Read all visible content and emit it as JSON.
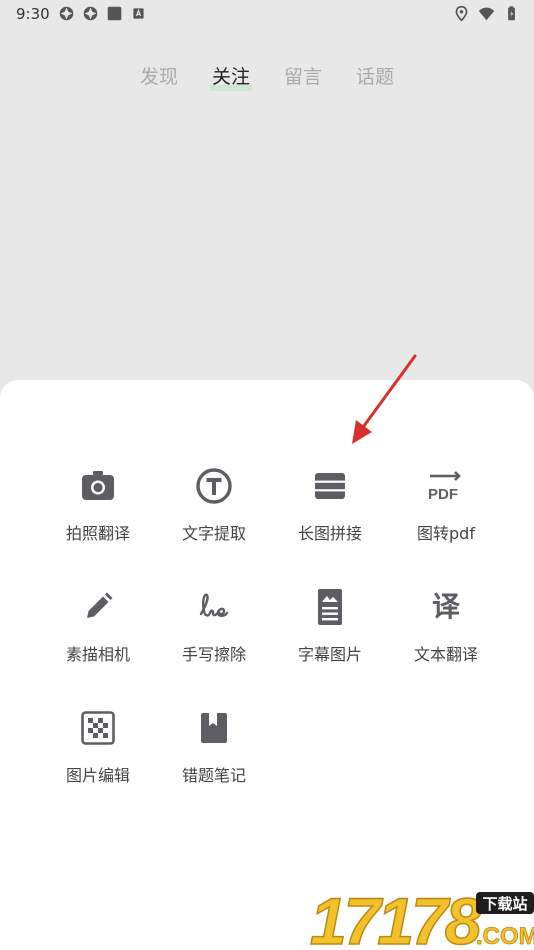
{
  "status_bar": {
    "time": "9:30",
    "left_icons": [
      "app-icon",
      "app-icon",
      "square-icon",
      "a-icon"
    ],
    "right_icons": [
      "location-icon",
      "wifi-icon",
      "battery-icon"
    ]
  },
  "tabs": [
    {
      "label": "发现",
      "active": false
    },
    {
      "label": "关注",
      "active": true
    },
    {
      "label": "留言",
      "active": false
    },
    {
      "label": "话题",
      "active": false
    }
  ],
  "tools": [
    {
      "label": "拍照翻译",
      "icon": "camera-icon"
    },
    {
      "label": "文字提取",
      "icon": "text-t-icon"
    },
    {
      "label": "长图拼接",
      "icon": "long-image-icon"
    },
    {
      "label": "图转pdf",
      "icon": "pdf-icon"
    },
    {
      "label": "素描相机",
      "icon": "pencil-icon"
    },
    {
      "label": "手写擦除",
      "icon": "handwriting-icon"
    },
    {
      "label": "字幕图片",
      "icon": "subtitle-image-icon"
    },
    {
      "label": "文本翻译",
      "icon": "translate-icon"
    },
    {
      "label": "图片编辑",
      "icon": "mosaic-icon"
    },
    {
      "label": "错题笔记",
      "icon": "bookmark-icon"
    }
  ],
  "icon_texts": {
    "pdf": "PDF",
    "translate": "译"
  },
  "watermark": {
    "brand": "17178",
    "badge": "下载站",
    "domain": ".COM"
  },
  "colors": {
    "background": "#e8e8e8",
    "sheet": "#ffffff",
    "icon": "#5d5d63",
    "tab_active_highlight": "#cde6d6",
    "arrow": "#d9302b"
  }
}
